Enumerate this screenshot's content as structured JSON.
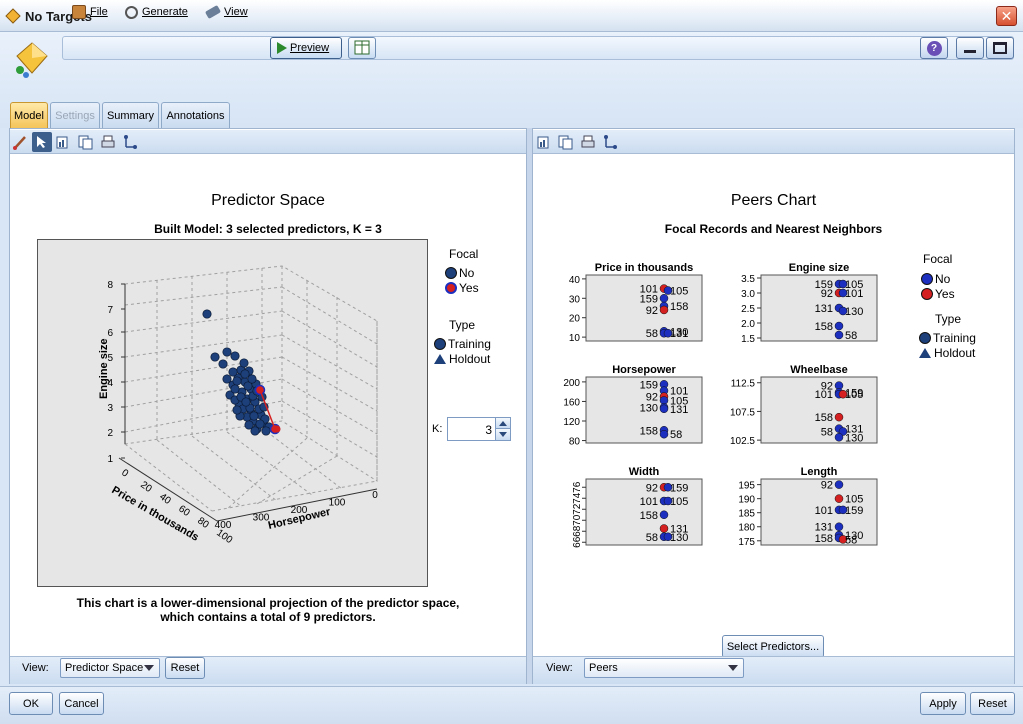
{
  "window": {
    "title": "No Targets",
    "close_glyph": "✕"
  },
  "menu": {
    "file": "File",
    "generate": "Generate",
    "view": "View",
    "preview": "Preview"
  },
  "tabs": [
    {
      "label": "Model",
      "state": "active"
    },
    {
      "label": "Settings",
      "state": "disabled"
    },
    {
      "label": "Summary",
      "state": "normal"
    },
    {
      "label": "Annotations",
      "state": "normal"
    }
  ],
  "left": {
    "title": "Predictor Space",
    "subtitle": "Built Model: 3 selected predictors, K = 3",
    "z_axis_label": "Engine size",
    "x_axis_label": "Price in thousands",
    "y_axis_label": "Horsepower",
    "z_ticks": [
      "1",
      "2",
      "3",
      "4",
      "5",
      "6",
      "7",
      "8"
    ],
    "price_ticks": [
      "0",
      "20",
      "40",
      "60",
      "80",
      "100"
    ],
    "hp_ticks": [
      "400",
      "300",
      "200",
      "100",
      "0"
    ],
    "legend": {
      "focal_title": "Focal",
      "focal_no": "No",
      "focal_yes": "Yes",
      "type_title": "Type",
      "type_training": "Training",
      "type_holdout": "Holdout"
    },
    "k_label": "K:",
    "k_value": "3",
    "caption_line1": "This chart is a lower-dimensional projection of the predictor space,",
    "caption_line2": "which contains a total of 9 predictors.",
    "view_label": "View:",
    "view_value": "Predictor Space",
    "reset_label": "Reset"
  },
  "right": {
    "title": "Peers Chart",
    "subtitle": "Focal Records and Nearest Neighbors",
    "legend": {
      "focal_title": "Focal",
      "focal_no": "No",
      "focal_yes": "Yes",
      "type_title": "Type",
      "type_training": "Training",
      "type_holdout": "Holdout"
    },
    "select_predictors_label": "Select Predictors...",
    "view_label": "View:",
    "view_value": "Peers"
  },
  "footer": {
    "ok": "OK",
    "cancel": "Cancel",
    "apply": "Apply",
    "reset": "Reset"
  },
  "colors": {
    "focal_no": "#1c2fbf",
    "focal_yes": "#d42020",
    "training_fill": "#1d3f7a",
    "tab_active": "#f5c45a"
  },
  "chart_data": [
    {
      "type": "scatter",
      "title": "Price in thousands",
      "ylim": [
        8,
        42
      ],
      "yticks": [
        "40",
        "30",
        "20",
        "10"
      ],
      "ytick_values": [
        40,
        30,
        20,
        10
      ],
      "points": [
        {
          "label": "101",
          "value": 35,
          "focal": "yes"
        },
        {
          "label": "105",
          "value": 34,
          "focal": "no"
        },
        {
          "label": "159",
          "value": 30,
          "focal": "no"
        },
        {
          "label": "158",
          "value": 26,
          "focal": "no"
        },
        {
          "label": "92",
          "value": 24,
          "focal": "yes"
        },
        {
          "label": "130",
          "value": 13,
          "focal": "no"
        },
        {
          "label": "58",
          "value": 12,
          "focal": "no"
        },
        {
          "label": "131",
          "value": 12,
          "focal": "no"
        }
      ]
    },
    {
      "type": "scatter",
      "title": "Engine size",
      "ylim": [
        1.4,
        3.6
      ],
      "yticks": [
        "3.5",
        "3.0",
        "2.5",
        "2.0",
        "1.5"
      ],
      "ytick_values": [
        3.5,
        3.0,
        2.5,
        2.0,
        1.5
      ],
      "points": [
        {
          "label": "159",
          "value": 3.3,
          "focal": "no"
        },
        {
          "label": "105",
          "value": 3.3,
          "focal": "no"
        },
        {
          "label": "92",
          "value": 3.0,
          "focal": "yes"
        },
        {
          "label": "101",
          "value": 3.0,
          "focal": "no"
        },
        {
          "label": "131",
          "value": 2.5,
          "focal": "no"
        },
        {
          "label": "130",
          "value": 2.4,
          "focal": "no"
        },
        {
          "label": "158",
          "value": 1.9,
          "focal": "no"
        },
        {
          "label": "58",
          "value": 1.6,
          "focal": "no"
        }
      ]
    },
    {
      "type": "scatter",
      "title": "Horsepower",
      "ylim": [
        75,
        210
      ],
      "yticks": [
        "200",
        "160",
        "120",
        "80"
      ],
      "ytick_values": [
        200,
        160,
        120,
        80
      ],
      "points": [
        {
          "label": "159",
          "value": 195,
          "focal": "no"
        },
        {
          "label": "101",
          "value": 182,
          "focal": "no"
        },
        {
          "label": "92",
          "value": 170,
          "focal": "yes"
        },
        {
          "label": "105",
          "value": 162,
          "focal": "no"
        },
        {
          "label": "130",
          "value": 148,
          "focal": "no"
        },
        {
          "label": "131",
          "value": 145,
          "focal": "no"
        },
        {
          "label": "158",
          "value": 101,
          "focal": "no"
        },
        {
          "label": "58",
          "value": 93,
          "focal": "no"
        }
      ]
    },
    {
      "type": "scatter",
      "title": "Wheelbase",
      "ylim": [
        102,
        113.5
      ],
      "yticks": [
        "112.5",
        "107.5",
        "102.5"
      ],
      "ytick_values": [
        112.5,
        107.5,
        102.5
      ],
      "points": [
        {
          "label": "92",
          "value": 112,
          "focal": "no"
        },
        {
          "label": "159",
          "value": 110.8,
          "focal": "no"
        },
        {
          "label": "101",
          "value": 110.5,
          "focal": "no"
        },
        {
          "label": "105",
          "value": 110.5,
          "focal": "yes"
        },
        {
          "label": "158",
          "value": 106.5,
          "focal": "yes"
        },
        {
          "label": "131",
          "value": 104.5,
          "focal": "no"
        },
        {
          "label": "58",
          "value": 104,
          "focal": "no"
        },
        {
          "label": "130",
          "value": 103,
          "focal": "no"
        }
      ]
    },
    {
      "type": "scatter",
      "title": "Width",
      "ylim": [
        65.5,
        77.5
      ],
      "yticks": [
        "66",
        "68",
        "70",
        "72",
        "74",
        "76"
      ],
      "ytick_values": [
        66,
        68,
        70,
        72,
        74,
        76
      ],
      "ytick_rotated": true,
      "points": [
        {
          "label": "92",
          "value": 76,
          "focal": "yes"
        },
        {
          "label": "159",
          "value": 76,
          "focal": "no"
        },
        {
          "label": "101",
          "value": 73.5,
          "focal": "no"
        },
        {
          "label": "105",
          "value": 73.5,
          "focal": "no"
        },
        {
          "label": "158",
          "value": 71,
          "focal": "no"
        },
        {
          "label": "131",
          "value": 68.5,
          "focal": "yes"
        },
        {
          "label": "58",
          "value": 67,
          "focal": "no"
        },
        {
          "label": "130",
          "value": 67,
          "focal": "no"
        }
      ]
    },
    {
      "type": "scatter",
      "title": "Length",
      "ylim": [
        173.5,
        197
      ],
      "yticks": [
        "195",
        "190",
        "185",
        "180",
        "175"
      ],
      "ytick_values": [
        195,
        190,
        185,
        180,
        175
      ],
      "points": [
        {
          "label": "92",
          "value": 195,
          "focal": "no"
        },
        {
          "label": "105",
          "value": 190,
          "focal": "yes"
        },
        {
          "label": "101",
          "value": 186,
          "focal": "no"
        },
        {
          "label": "159",
          "value": 186,
          "focal": "no"
        },
        {
          "label": "131",
          "value": 180,
          "focal": "no"
        },
        {
          "label": "130",
          "value": 177,
          "focal": "no"
        },
        {
          "label": "158",
          "value": 176,
          "focal": "no"
        },
        {
          "label": "58",
          "value": 175.5,
          "focal": "yes"
        }
      ]
    }
  ]
}
